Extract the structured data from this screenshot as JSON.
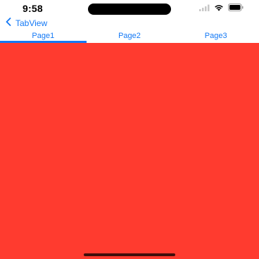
{
  "status_bar": {
    "time": "9:58",
    "icons": [
      "cellular-signal-icon",
      "wifi-icon",
      "battery-icon"
    ]
  },
  "nav": {
    "back_label": "TabView",
    "back_icon": "chevron-left-icon"
  },
  "tabs": [
    {
      "label": "Page1",
      "selected": true
    },
    {
      "label": "Page2",
      "selected": false
    },
    {
      "label": "Page3",
      "selected": false
    }
  ],
  "content": {
    "color": "#ff3b2f"
  },
  "colors": {
    "accent": "#1479f5",
    "page_background": "#ff3b2f"
  }
}
